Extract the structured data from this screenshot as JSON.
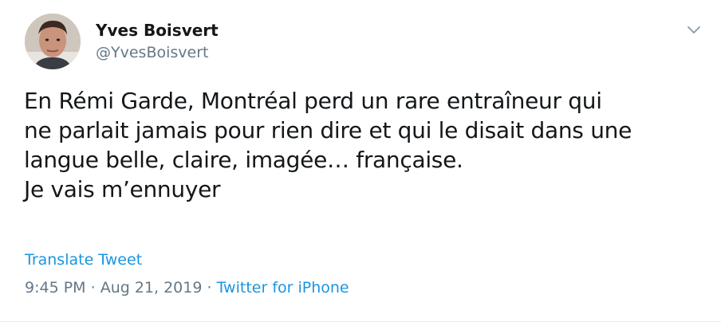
{
  "tweet": {
    "author": {
      "display_name": "Yves Boisvert",
      "handle": "@YvesBoisvert"
    },
    "text_lines": [
      "En Rémi Garde, Montréal perd un rare entraîneur qui",
      "ne parlait jamais pour rien dire et qui le disait dans une",
      "langue belle, claire, imagée… française.",
      "Je vais m’ennuyer"
    ],
    "translate_label": "Translate Tweet",
    "time": "9:45 PM",
    "date": "Aug 21, 2019",
    "separator": "·",
    "source": "Twitter for iPhone"
  },
  "icons": {
    "menu": "chevron-down-icon"
  },
  "colors": {
    "text": "#14171a",
    "secondary": "#657786",
    "link": "#1b95e0",
    "border": "#e6ecf0"
  }
}
